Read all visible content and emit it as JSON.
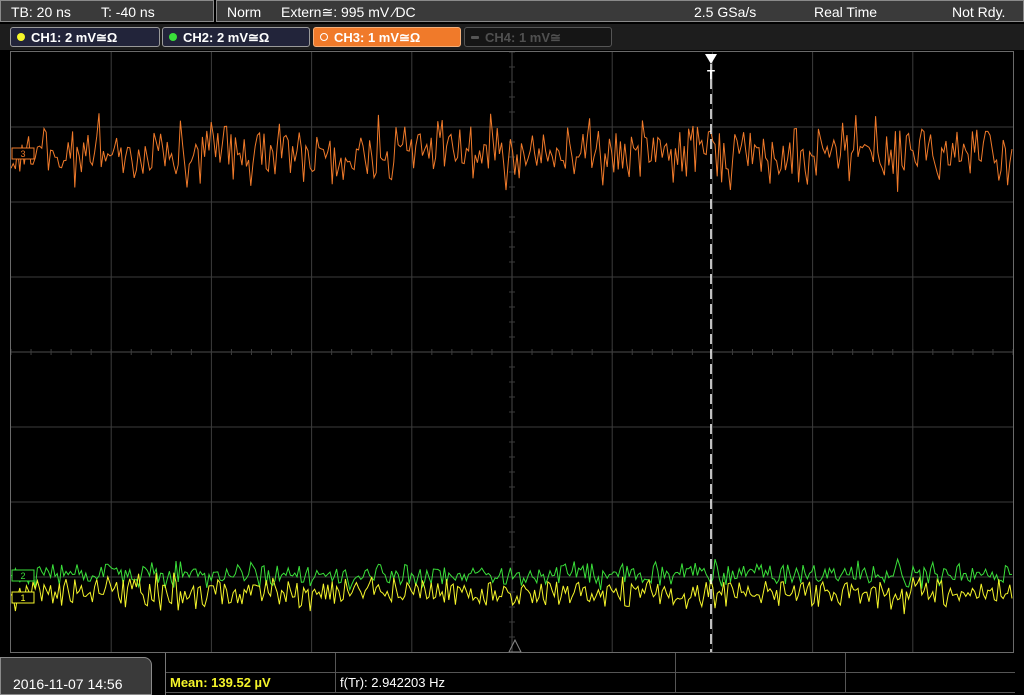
{
  "topbar": {
    "timebase": "TB: 20 ns",
    "trigger_pos": "T: -40 ns",
    "acq_mode": "Norm",
    "trigger_source": "Extern≅: 995 mV ⁄DC",
    "sample_rate": "2.5 GSa/s",
    "time_mode": "Real Time",
    "trigger_status": "Not Rdy."
  },
  "channels": [
    {
      "label": "CH1: 2 mV≅Ω",
      "color": "#f5f52a",
      "state": "on"
    },
    {
      "label": "CH2: 2 mV≅Ω",
      "color": "#3adf3a",
      "state": "on"
    },
    {
      "label": "CH3: 1 mV≅Ω",
      "color": "#f07a2a",
      "state": "active"
    },
    {
      "label": "CH4: 1 mV≅",
      "color": "#555555",
      "state": "off"
    }
  ],
  "markers": {
    "trigger": "T",
    "ch3_ref": "3",
    "ch2_ref": "2",
    "ch1_ref": "1"
  },
  "colors": {
    "grid": "#3c3c3c",
    "ch1": "#f5f52a",
    "ch2": "#3adf3a",
    "ch3": "#f07a2a",
    "trigger_line": "#ffffff"
  },
  "datetime": "2016-11-07 14:56",
  "measurements": {
    "mean": "Mean: 139.52 µV",
    "frequency": "f(Tr): 2.942203 Hz"
  }
}
